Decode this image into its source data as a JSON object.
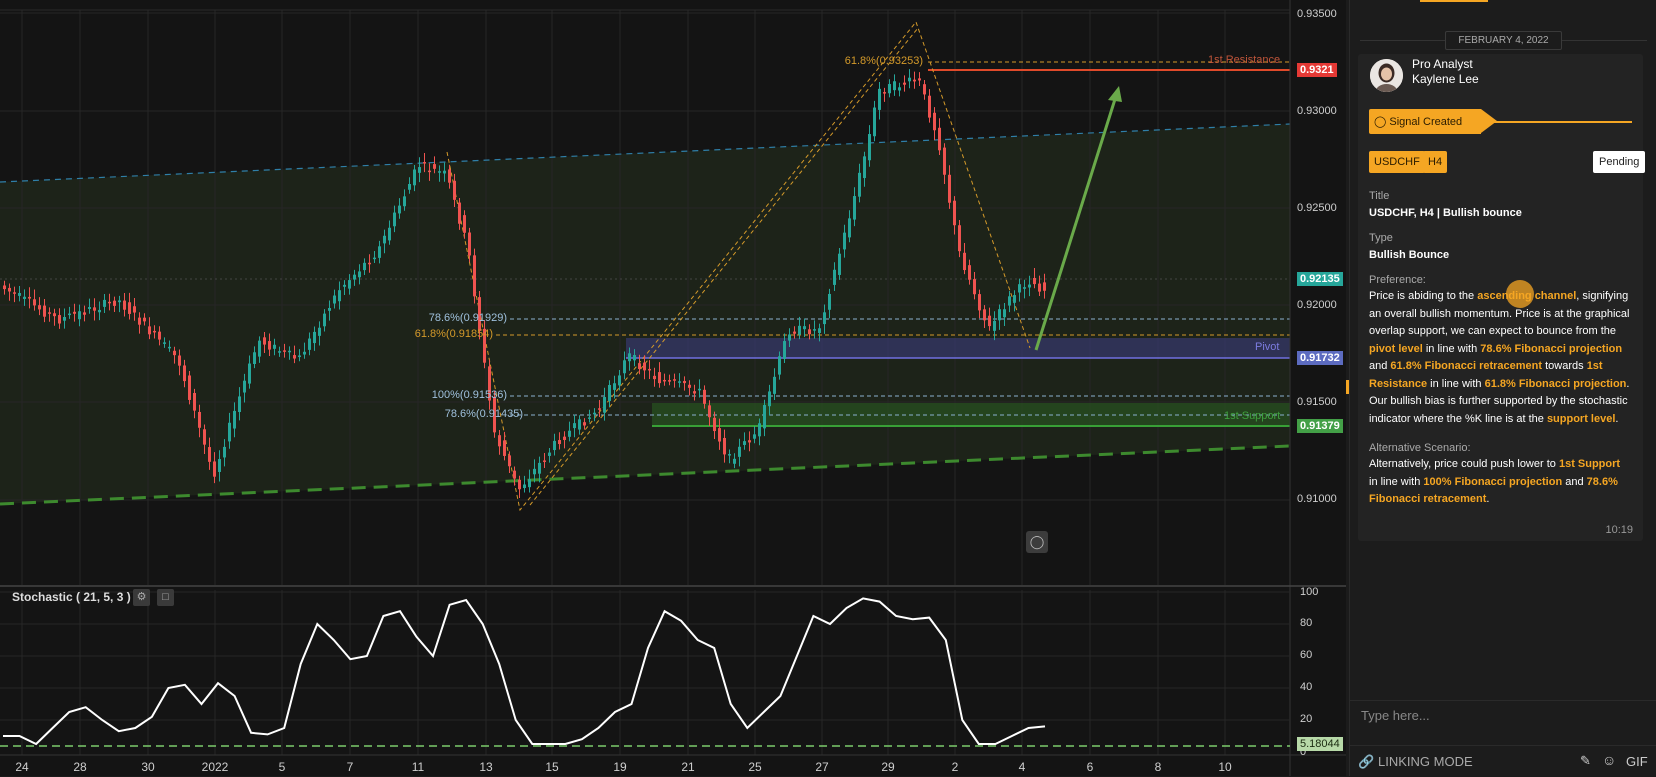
{
  "chart": {
    "price_axis": [
      "0.93500",
      "0.93000",
      "0.92500",
      "0.92000",
      "0.91500",
      "0.91000"
    ],
    "price_tags": {
      "resistance": "0.9321",
      "current": "0.92135",
      "pivot": "0.91732",
      "support": "0.91379"
    },
    "tag_colors": {
      "resistance": "#e53935",
      "current": "#26a69a",
      "pivot": "#5c6bc0",
      "support": "#43a047"
    },
    "fib_labels": {
      "fib_618_top": "61.8%(0.93253)",
      "fib_786_a": "78.6%(0.91929)",
      "fib_618_b": "61.8%(0.91854)",
      "fib_100": "100%(0.91536)",
      "fib_786_b": "78.6%(0.91435)"
    },
    "zones": {
      "resistance": "1st Resistance",
      "pivot": "Pivot",
      "support": "1st Support"
    },
    "date_axis": [
      "24",
      "28",
      "30",
      "2022",
      "5",
      "7",
      "11",
      "13",
      "15",
      "19",
      "21",
      "25",
      "27",
      "29",
      "2",
      "4",
      "6",
      "8",
      "10"
    ]
  },
  "stochastic": {
    "title": "Stochastic ( 21, 5, 3 )",
    "axis": [
      "100",
      "80",
      "60",
      "40",
      "20",
      "0"
    ],
    "current_value": "5.18044",
    "k_series": [
      10,
      10,
      5,
      15,
      25,
      28,
      20,
      13,
      15,
      22,
      40,
      42,
      30,
      43,
      35,
      12,
      11,
      15,
      55,
      80,
      70,
      58,
      60,
      85,
      88,
      72,
      60,
      92,
      95,
      80,
      55,
      20,
      5,
      5,
      5,
      8,
      15,
      25,
      30,
      65,
      88,
      82,
      70,
      65,
      30,
      15,
      25,
      35,
      60,
      85,
      80,
      90,
      96,
      94,
      85,
      83,
      84,
      70,
      20,
      5,
      5,
      10,
      15,
      16
    ]
  },
  "sidebar": {
    "date": "FEBRUARY 4, 2022",
    "analyst_role": "Pro Analyst",
    "analyst_name": "Kaylene Lee",
    "signal": "Signal Created",
    "tags": [
      "USDCHF",
      "H4"
    ],
    "status": "Pending",
    "title_label": "Title",
    "title_value": "USDCHF, H4 | Bullish bounce",
    "type_label": "Type",
    "type_value": "Bullish Bounce",
    "preference_label": "Preference:",
    "preference": {
      "t1": "Price is abiding to the ",
      "h1": "ascending channel",
      "t2": ", signifying an overall bullish momentum. Price is at the graphical overlap support, we can expect to bounce from the ",
      "h2": "pivot level",
      "t3": " in line with ",
      "h3": "78.6% Fibonacci projection",
      "t4": " and ",
      "h4": "61.8% Fibonacci retracement",
      "t5": " towards ",
      "h5": "1st Resistance",
      "t6": " in line with ",
      "h6": "61.8% Fibonacci projection",
      "t7": ". Our bullish bias is further supported by the stochastic indicator where the %K line is at the ",
      "h7": "support level",
      "t8": "."
    },
    "alt_label": "Alternative Scenario:",
    "alternative": {
      "t1": "Alternatively, price could push lower to ",
      "h1": "1st Support",
      "t2": " in line with ",
      "h2": "100% Fibonacci projection",
      "t3": " and ",
      "h3": "78.6% Fibonacci retracement",
      "t4": "."
    },
    "time": "10:19",
    "input_placeholder": "Type here...",
    "linking_mode": "LINKING MODE",
    "gif": "GIF"
  }
}
